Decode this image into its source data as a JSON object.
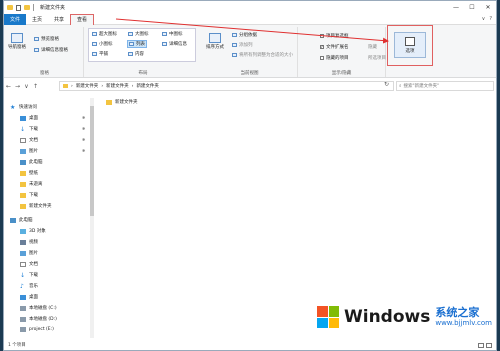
{
  "window": {
    "title": "新建文件夹"
  },
  "titlebar": {
    "minimize": "—",
    "maximize": "☐",
    "close": "✕"
  },
  "tabs": [
    {
      "label": "文件"
    },
    {
      "label": "主页"
    },
    {
      "label": "共享"
    },
    {
      "label": "查看"
    }
  ],
  "tabs_right": {
    "chevron": "∨",
    "help": "?"
  },
  "ribbon": {
    "pane_group": {
      "nav_pane": "导航窗格",
      "preview_pane": "预览窗格",
      "details_pane": "详细信息窗格",
      "label": "窗格"
    },
    "layout_group": {
      "items": [
        "超大图标",
        "大图标",
        "中图标",
        "小图标",
        "列表",
        "详细信息",
        "平铺",
        "内容"
      ],
      "selected": "列表",
      "label": "布局"
    },
    "current_view_group": {
      "sort_by": "排序方式",
      "group_by": "分组依据",
      "add_columns": "添加列",
      "fit_columns": "将所有列调整为合适的大小",
      "label": "当前视图"
    },
    "show_hide_group": {
      "item_checkbox": "项目复选框",
      "file_extensions": "文件扩展名",
      "hidden_items": "隐藏的项目",
      "hide": "隐藏",
      "hide_selected": "所选项目",
      "file_extensions_checked": true,
      "label": "显示/隐藏"
    },
    "options": {
      "label": "选项"
    }
  },
  "address": {
    "crumbs": [
      "新建文件夹",
      "新建文件夹",
      "新建文件夹"
    ],
    "search_placeholder": "搜索\"新建文件夹\""
  },
  "nav_pane": {
    "quick_access": "快速访问",
    "items": [
      {
        "label": "桌面",
        "pinned": true
      },
      {
        "label": "下载",
        "pinned": true
      },
      {
        "label": "文档",
        "pinned": true
      },
      {
        "label": "图片",
        "pinned": true
      },
      {
        "label": "此电脑",
        "pinned": false
      },
      {
        "label": "壁纸",
        "pinned": false
      },
      {
        "label": "未遊离",
        "pinned": false
      },
      {
        "label": "下载",
        "pinned": false
      },
      {
        "label": "新建文件夹",
        "pinned": false
      }
    ],
    "this_pc": "此电脑",
    "pc_items": [
      "3D 对象",
      "视频",
      "图片",
      "文档",
      "下载",
      "音乐",
      "桌面",
      "本地磁盘 (C:)",
      "本地磁盘 (D:)",
      "project (E:)"
    ]
  },
  "content": {
    "files": [
      {
        "name": "新建文件夹"
      }
    ]
  },
  "status": {
    "count": "1 个项目"
  },
  "watermark": {
    "brand": "Windows",
    "sub": "系统之家",
    "url": "www.bjjmlv.com"
  }
}
